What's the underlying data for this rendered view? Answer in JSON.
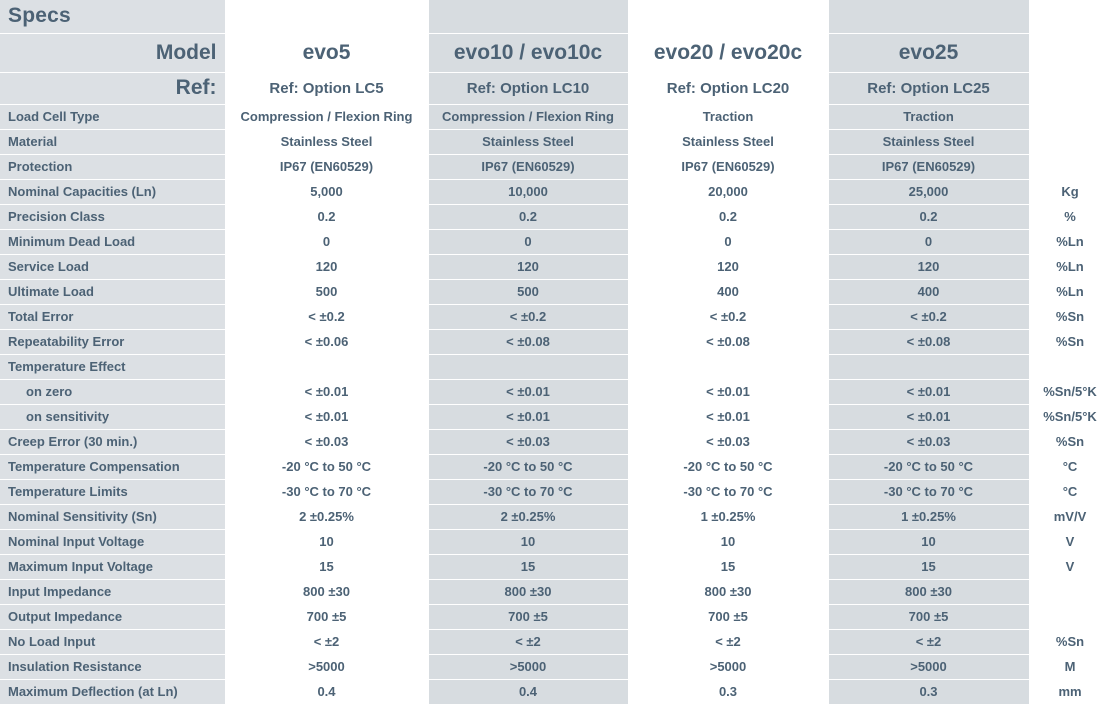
{
  "title": "Specs",
  "colors": {
    "text": "#4c6275",
    "label_bg": "#dce0e4",
    "alt_bg": "#d7dce0",
    "plain_bg": "#ffffff",
    "grid": "#ffffff"
  },
  "header": {
    "specs_label": "Specs",
    "model_label": "Model",
    "ref_label": "Ref:",
    "models": [
      "evo5",
      "evo10 / evo10c",
      "evo20 / evo20c",
      "evo25"
    ],
    "refs": [
      "Ref: Option LC5",
      "Ref: Option LC10",
      "Ref: Option LC20",
      "Ref: Option LC25"
    ],
    "unit_header_specs": "",
    "unit_header_model": "",
    "unit_header_ref": ""
  },
  "column_shading": [
    "plain",
    "alt",
    "plain",
    "alt"
  ],
  "rows": [
    {
      "label": "Load Cell Type",
      "indent": false,
      "values": [
        "Compression / Flexion Ring",
        "Compression / Flexion Ring",
        "Traction",
        "Traction"
      ],
      "unit": ""
    },
    {
      "label": "Material",
      "indent": false,
      "values": [
        "Stainless Steel",
        "Stainless Steel",
        "Stainless Steel",
        "Stainless Steel"
      ],
      "unit": ""
    },
    {
      "label": "Protection",
      "indent": false,
      "values": [
        "IP67 (EN60529)",
        "IP67 (EN60529)",
        "IP67 (EN60529)",
        "IP67 (EN60529)"
      ],
      "unit": ""
    },
    {
      "label": "Nominal Capacities (Ln)",
      "indent": false,
      "values": [
        "5,000",
        "10,000",
        "20,000",
        "25,000"
      ],
      "unit": "Kg"
    },
    {
      "label": "Precision Class",
      "indent": false,
      "values": [
        "0.2",
        "0.2",
        "0.2",
        "0.2"
      ],
      "unit": "%"
    },
    {
      "label": "Minimum Dead Load",
      "indent": false,
      "values": [
        "0",
        "0",
        "0",
        "0"
      ],
      "unit": "%Ln"
    },
    {
      "label": "Service Load",
      "indent": false,
      "values": [
        "120",
        "120",
        "120",
        "120"
      ],
      "unit": "%Ln"
    },
    {
      "label": "Ultimate Load",
      "indent": false,
      "values": [
        "500",
        "500",
        "400",
        "400"
      ],
      "unit": "%Ln"
    },
    {
      "label": "Total Error",
      "indent": false,
      "values": [
        "< ±0.2",
        "< ±0.2",
        "< ±0.2",
        "< ±0.2"
      ],
      "unit": "%Sn"
    },
    {
      "label": "Repeatability Error",
      "indent": false,
      "values": [
        "< ±0.06",
        "< ±0.08",
        "< ±0.08",
        "< ±0.08"
      ],
      "unit": "%Sn"
    },
    {
      "label": "Temperature Effect",
      "indent": false,
      "values": [
        "",
        "",
        "",
        ""
      ],
      "unit": ""
    },
    {
      "label": "on zero",
      "indent": true,
      "values": [
        "< ±0.01",
        "< ±0.01",
        "< ±0.01",
        "< ±0.01"
      ],
      "unit": "%Sn/5°K"
    },
    {
      "label": "on sensitivity",
      "indent": true,
      "values": [
        "< ±0.01",
        "< ±0.01",
        "< ±0.01",
        "< ±0.01"
      ],
      "unit": "%Sn/5°K"
    },
    {
      "label": "Creep Error (30 min.)",
      "indent": false,
      "values": [
        "< ±0.03",
        "< ±0.03",
        "< ±0.03",
        "< ±0.03"
      ],
      "unit": "%Sn"
    },
    {
      "label": "Temperature Compensation",
      "indent": false,
      "values": [
        "-20 °C to 50 °C",
        "-20 °C to 50 °C",
        "-20 °C to 50 °C",
        "-20 °C to 50 °C"
      ],
      "unit": "°C"
    },
    {
      "label": "Temperature Limits",
      "indent": false,
      "values": [
        "-30 °C to 70 °C",
        "-30 °C to 70 °C",
        "-30 °C to 70 °C",
        "-30 °C to 70 °C"
      ],
      "unit": "°C"
    },
    {
      "label": "Nominal Sensitivity (Sn)",
      "indent": false,
      "values": [
        "2 ±0.25%",
        "2 ±0.25%",
        "1 ±0.25%",
        "1 ±0.25%"
      ],
      "unit": "mV/V"
    },
    {
      "label": "Nominal Input Voltage",
      "indent": false,
      "values": [
        "10",
        "10",
        "10",
        "10"
      ],
      "unit": "V"
    },
    {
      "label": "Maximum Input Voltage",
      "indent": false,
      "values": [
        "15",
        "15",
        "15",
        "15"
      ],
      "unit": "V"
    },
    {
      "label": "Input Impedance",
      "indent": false,
      "values": [
        "800 ±30",
        "800 ±30",
        "800 ±30",
        "800 ±30"
      ],
      "unit": ""
    },
    {
      "label": "Output Impedance",
      "indent": false,
      "values": [
        "700 ±5",
        "700 ±5",
        "700 ±5",
        "700 ±5"
      ],
      "unit": ""
    },
    {
      "label": "No Load Input",
      "indent": false,
      "values": [
        "< ±2",
        "< ±2",
        "< ±2",
        "< ±2"
      ],
      "unit": "%Sn"
    },
    {
      "label": "Insulation Resistance",
      "indent": false,
      "values": [
        ">5000",
        ">5000",
        ">5000",
        ">5000"
      ],
      "unit": "M"
    },
    {
      "label": "Maximum Deflection (at Ln)",
      "indent": false,
      "values": [
        "0.4",
        "0.4",
        "0.3",
        "0.3"
      ],
      "unit": "mm"
    }
  ]
}
